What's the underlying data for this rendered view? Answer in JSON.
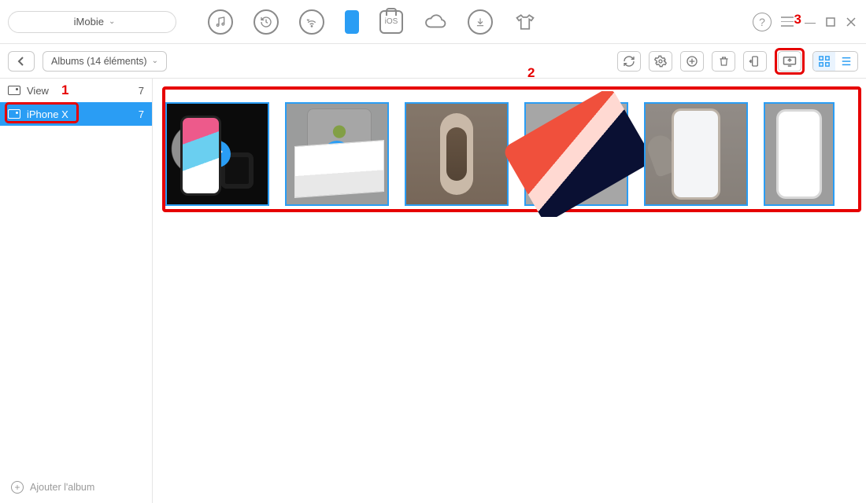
{
  "brand": {
    "label": "iMobie"
  },
  "breadcrumb": {
    "label": "Albums (14 éléments)"
  },
  "sidebar": {
    "items": [
      {
        "label": "View",
        "count": "7"
      },
      {
        "label": "iPhone X",
        "count": "7"
      }
    ],
    "footer": "Ajouter l'album"
  },
  "callouts": {
    "one": "1",
    "two": "2",
    "three": "3"
  },
  "iosLabel": "iOS"
}
